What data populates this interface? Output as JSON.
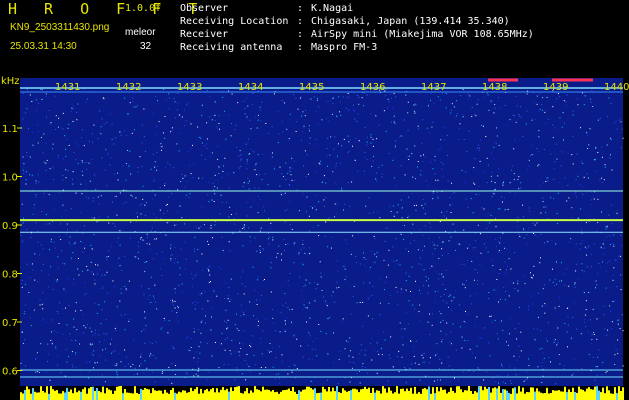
{
  "header": {
    "title": "H R O F F T",
    "version": "1.0.0f",
    "filename": "KN9_2503311430.png",
    "unit_label": "meleor",
    "datetime": "25.03.31 14:30",
    "unit_value": "32"
  },
  "info": [
    {
      "label": "Observer",
      "value": "K.Nagai"
    },
    {
      "label": "Receiving Location",
      "value": "Chigasaki, Japan (139.414 35.340)"
    },
    {
      "label": "Receiver",
      "value": "AirSpy mini (Miakejima VOR 108.65MHz)"
    },
    {
      "label": "Receiving antenna",
      "value": "Maspro FM-3"
    }
  ],
  "axis": {
    "unit": "kHz",
    "y_ticks": [
      "1.1",
      "1.0",
      "0.9",
      "0.8",
      "0.7",
      "0.6"
    ]
  },
  "time_ticks": [
    "1431",
    "1432",
    "1433",
    "1434",
    "1435",
    "1436",
    "1437",
    "1438",
    "1439",
    "1440"
  ],
  "colors": {
    "background": "#000000",
    "plot_bg": "#0a1b8a",
    "header_text": "#e6e600",
    "axis_text": "#e6e600",
    "trace": "#c8ff40"
  }
}
